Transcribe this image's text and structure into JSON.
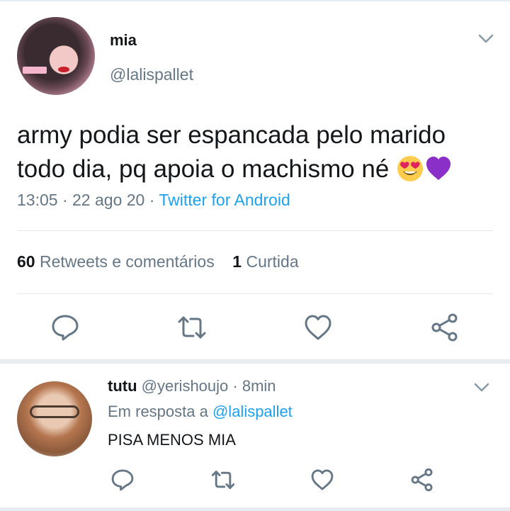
{
  "tweet": {
    "display_name": "mia",
    "handle": "@lalispallet",
    "text_line1": "army podia ser espancada pelo marido",
    "text_line2": "todo dia, pq apoia o machismo né",
    "emojis": [
      "heart-eyes-emoji",
      "purple-heart-emoji"
    ],
    "time": "13:05",
    "date": "22 ago 20",
    "client": "Twitter for Android",
    "separator": "·",
    "retweets_count": "60",
    "retweets_label": "Retweets e comentários",
    "likes_count": "1",
    "likes_label": "Curtida",
    "actions": [
      "reply-icon",
      "retweet-icon",
      "like-icon",
      "share-icon"
    ]
  },
  "reply": {
    "display_name": "tutu",
    "handle": "@yerishoujo",
    "separator": "·",
    "age": "8min",
    "replying_prefix": "Em resposta a",
    "replying_to": "@lalispallet",
    "text": "PISA MENOS MIA"
  },
  "colors": {
    "accent": "#1da1f2",
    "secondary_text": "#657786",
    "primary_text": "#14171a",
    "divider": "#e1e8ed",
    "purple_heart": "#8b2fc9"
  }
}
